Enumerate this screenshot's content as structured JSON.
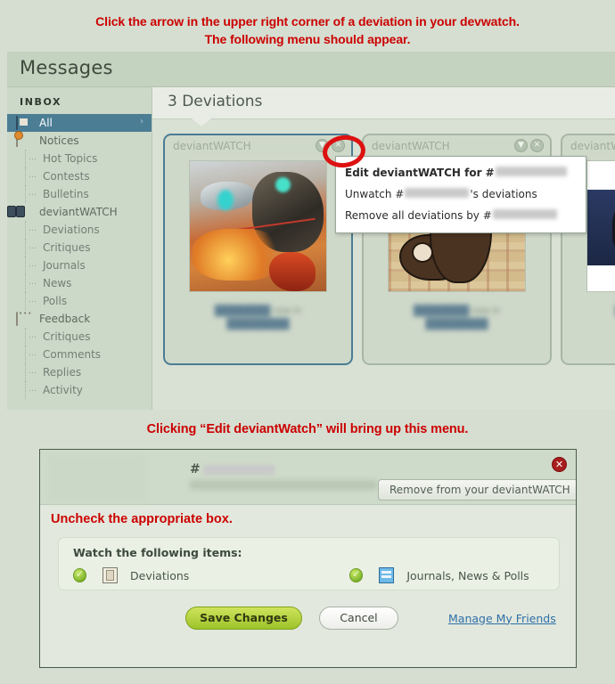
{
  "annotations": {
    "top_line1": "Click the arrow in the upper right corner of a deviation in your devwatch.",
    "top_line2": "The following menu should appear.",
    "middle": "Clicking “Edit deviantWatch” will bring up this menu.",
    "uncheck": "Uncheck the appropriate box.",
    "accent_color": "#cc0000"
  },
  "messages": {
    "title": "Messages",
    "sidebar": {
      "section_label": "INBOX",
      "items": [
        {
          "label": "All",
          "icon": "mail-icon",
          "level": "top",
          "active": true,
          "chevron": "›"
        },
        {
          "label": "Notices",
          "icon": "note-icon",
          "level": "top",
          "active": false
        },
        {
          "label": "Hot Topics",
          "level": "child",
          "active": false
        },
        {
          "label": "Contests",
          "level": "child",
          "active": false
        },
        {
          "label": "Bulletins",
          "level": "child",
          "active": false
        },
        {
          "label": "deviantWATCH",
          "icon": "binoculars-icon",
          "level": "top",
          "active": false
        },
        {
          "label": "Deviations",
          "level": "child",
          "active": false
        },
        {
          "label": "Critiques",
          "level": "child",
          "active": false
        },
        {
          "label": "Journals",
          "level": "child",
          "active": false
        },
        {
          "label": "News",
          "level": "child",
          "active": false
        },
        {
          "label": "Polls",
          "level": "child",
          "active": false
        },
        {
          "label": "Feedback",
          "icon": "speech-bubble-icon",
          "level": "top",
          "active": false
        },
        {
          "label": "Critiques",
          "level": "child",
          "active": false
        },
        {
          "label": "Comments",
          "level": "child",
          "active": false
        },
        {
          "label": "Replies",
          "level": "child",
          "active": false
        },
        {
          "label": "Activity",
          "level": "child",
          "active": false
        }
      ]
    },
    "main": {
      "heading": "3 Deviations",
      "cards": [
        {
          "header": "deviantWATCH",
          "selected": true,
          "art": "art1",
          "art_label": "",
          "buttons": [
            "chevron-down",
            "close"
          ]
        },
        {
          "header": "deviantWATCH",
          "selected": false,
          "art": "art2",
          "art_label": "From\nWangler",
          "buttons": [
            "chevron-down",
            "close"
          ]
        },
        {
          "header": "deviantWATCH",
          "selected": false,
          "art": "art3",
          "art_label": "",
          "buttons": [
            "chevron-down",
            "close"
          ]
        }
      ]
    }
  },
  "dropdown_menu": {
    "items": [
      {
        "prefix": "Edit deviantWATCH for #",
        "redacted": true,
        "suffix": "",
        "bold": true
      },
      {
        "prefix": "Unwatch #",
        "redacted": true,
        "suffix": "'s deviations",
        "bold": false
      },
      {
        "prefix": "Remove all deviations by #",
        "redacted": true,
        "suffix": "",
        "bold": false
      }
    ]
  },
  "dialog": {
    "username_hash": "#",
    "remove_button": "Remove from your deviantWATCH",
    "close_icon": "✕",
    "watch_panel": {
      "title": "Watch the following items:",
      "options": [
        {
          "label": "Deviations",
          "checked": true,
          "icon": "deviation-icon"
        },
        {
          "label": "Journals, News & Polls",
          "checked": true,
          "icon": "journal-icon"
        }
      ]
    },
    "actions": {
      "save": "Save Changes",
      "cancel": "Cancel",
      "manage_link": "Manage My Friends"
    }
  }
}
